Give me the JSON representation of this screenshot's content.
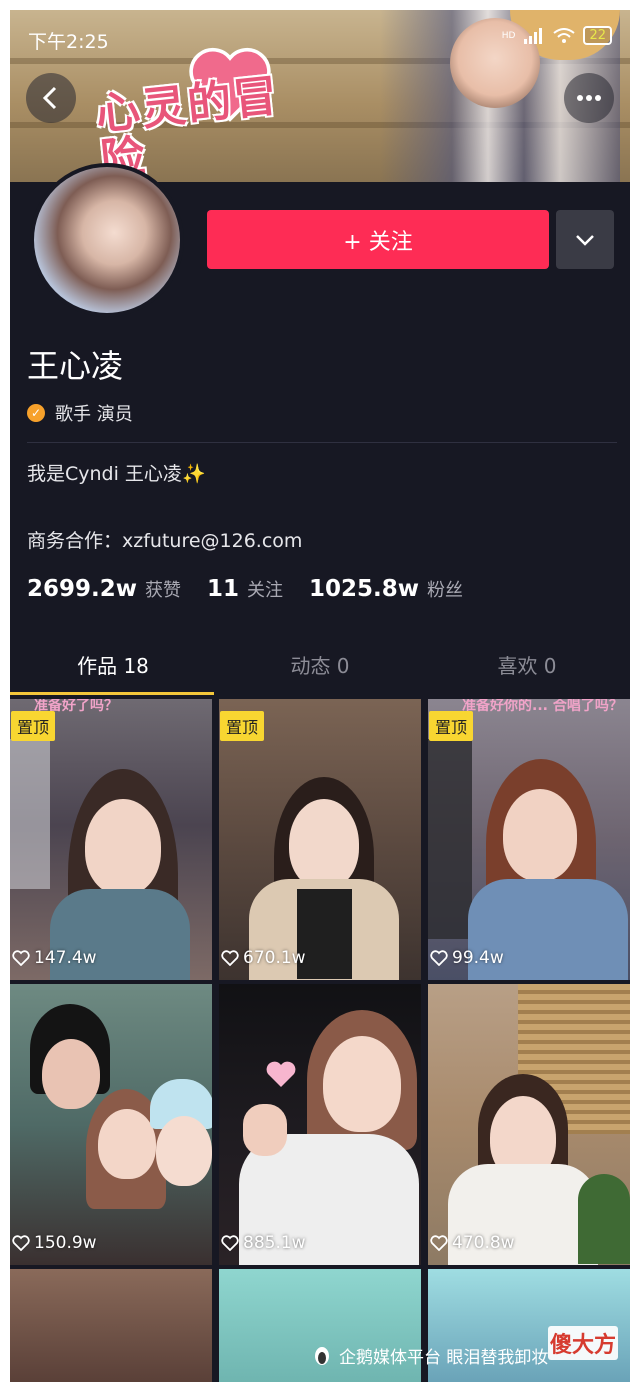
{
  "status_bar": {
    "time": "下午2:25",
    "battery": "22",
    "network": "HD"
  },
  "banner": {
    "logo_text": "心灵的冒险"
  },
  "profile": {
    "follow_label": "+ 关注",
    "name": "王心凌",
    "tags": "歌手  演员",
    "bio": "我是Cyndi 王心凌",
    "bio_emoji": "✨",
    "business": "商务合作：xzfuture@126.com"
  },
  "stats": {
    "likes_value": "2699.2w",
    "likes_label": "获赞",
    "following_value": "11",
    "following_label": "关注",
    "followers_value": "1025.8w",
    "followers_label": "粉丝"
  },
  "tabs": [
    {
      "label": "作品 18"
    },
    {
      "label": "动态 0"
    },
    {
      "label": "喜欢 0"
    }
  ],
  "videos": [
    {
      "pinned": "置顶",
      "likes": "147.4w",
      "caption": "准备好了吗？"
    },
    {
      "pinned": "置顶",
      "likes": "670.1w"
    },
    {
      "pinned": "置顶",
      "likes": "99.4w",
      "caption": "准备好你的... 合唱了吗？"
    },
    {
      "likes": "150.9w"
    },
    {
      "likes": "885.1w"
    },
    {
      "likes": "470.8w"
    }
  ],
  "watermark": {
    "text": "企鹅媒体平台 眼泪替我卸妆",
    "logo": "傻大方"
  },
  "colors": {
    "accent": "#fe2c55",
    "background": "#171823",
    "pin": "#f8d631",
    "tab_indicator": "#f3c63b"
  }
}
